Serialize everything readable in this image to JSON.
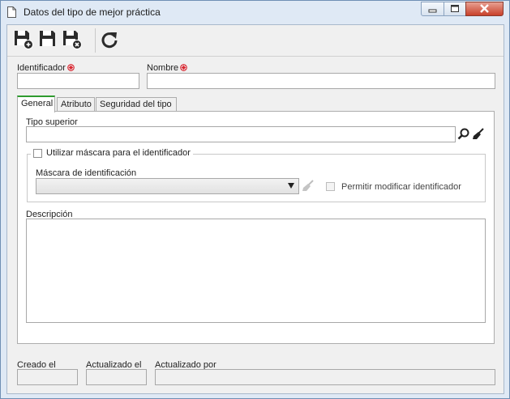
{
  "window": {
    "title": "Datos del tipo de mejor práctica"
  },
  "toolbar": {
    "buttons": [
      "save-new-icon",
      "save-icon",
      "save-close-icon",
      "refresh-icon"
    ]
  },
  "form": {
    "id_label": "Identificador",
    "id_value": "",
    "name_label": "Nombre",
    "name_value": ""
  },
  "tabs": [
    {
      "label": "General",
      "active": true
    },
    {
      "label": "Atributo",
      "active": false
    },
    {
      "label": "Seguridad del tipo",
      "active": false
    }
  ],
  "general": {
    "parent_type_label": "Tipo superior",
    "parent_type_value": "",
    "use_mask_label": "Utilizar máscara para el identificador",
    "use_mask_checked": false,
    "mask_label": "Máscara de identificación",
    "mask_value": "",
    "allow_modify_label": "Permitir modificar identificador",
    "allow_modify_checked": false,
    "description_label": "Descripción",
    "description_value": ""
  },
  "footer": {
    "created_label": "Creado el",
    "updated_label": "Actualizado el",
    "updated_by_label": "Actualizado por"
  },
  "colors": {
    "required": "#d9232d",
    "active_tab_accent": "#2e9b2e",
    "title_bar": "#dfe9f5",
    "close_button": "#c8402a"
  }
}
